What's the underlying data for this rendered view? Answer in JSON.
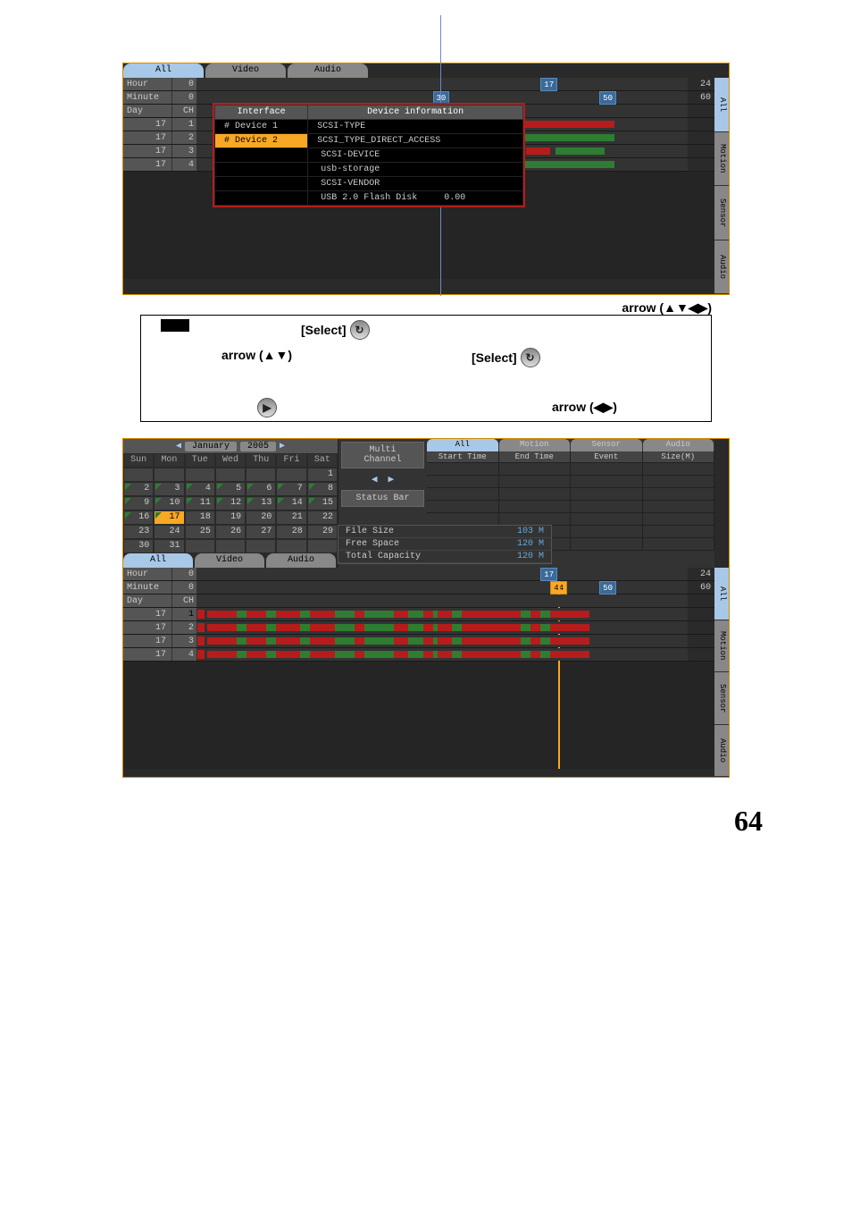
{
  "page_number": "64",
  "screenshot1": {
    "top_tabs": {
      "all": "All",
      "video": "Video",
      "audio": "Audio"
    },
    "side_tabs": {
      "all": "All",
      "motion": "Motion",
      "sensor": "Sensor",
      "audio": "Audio"
    },
    "hour": {
      "label": "Hour",
      "start": "0",
      "cursor": "17",
      "end": "24"
    },
    "minute": {
      "label": "Minute",
      "start": "0",
      "marker": "30",
      "cursor": "50",
      "end": "60"
    },
    "heading": {
      "day": "Day",
      "ch": "CH"
    },
    "channels": [
      {
        "day": "17",
        "ch": "1"
      },
      {
        "day": "17",
        "ch": "2"
      },
      {
        "day": "17",
        "ch": "3"
      },
      {
        "day": "17",
        "ch": "4"
      }
    ],
    "popup": {
      "col_interface": "Interface",
      "col_devinfo": "Device information",
      "device1": "# Device 1",
      "device2": "# Device 2",
      "info": {
        "l1": "SCSI-TYPE",
        "l2": "SCSI_TYPE_DIRECT_ACCESS",
        "l3": "SCSI-DEVICE",
        "l4": "usb-storage",
        "l5": "SCSI-VENDOR",
        "l6": "USB 2.0 Flash Disk",
        "val": "0.00"
      }
    }
  },
  "inter": {
    "arrow4": "arrow (▲▼◀▶)",
    "select": "[Select]",
    "arrow2v": "arrow (▲▼)",
    "arrow2h": "arrow (◀▶)"
  },
  "screenshot2": {
    "calendar": {
      "month": "January",
      "year": "2005",
      "days": [
        "Sun",
        "Mon",
        "Tue",
        "Wed",
        "Thu",
        "Fri",
        "Sat"
      ],
      "cells": [
        [
          "",
          "",
          "",
          "",
          "",
          "",
          "1"
        ],
        [
          "2",
          "3",
          "4",
          "5",
          "6",
          "7",
          "8"
        ],
        [
          "9",
          "10",
          "11",
          "12",
          "13",
          "14",
          "15"
        ],
        [
          "16",
          "17",
          "18",
          "19",
          "20",
          "21",
          "22"
        ],
        [
          "23",
          "24",
          "25",
          "26",
          "27",
          "28",
          "29"
        ],
        [
          "30",
          "31",
          "",
          "",
          "",
          "",
          ""
        ]
      ],
      "hasdata_from": 2,
      "hasdata_to": 17,
      "selected": "17"
    },
    "bottom_tabs": {
      "all": "All",
      "video": "Video",
      "audio": "Audio"
    },
    "mid": {
      "multi": "Multi\nChannel",
      "status": "Status Bar"
    },
    "stats": {
      "filesize_l": "File Size",
      "filesize_v": "103 M",
      "freespace_l": "Free Space",
      "freespace_v": "120 M",
      "total_l": "Total Capacity",
      "total_v": "120 M"
    },
    "right_tabs": {
      "all": "All",
      "motion": "Motion",
      "sensor": "Sensor",
      "audio": "Audio"
    },
    "right_cols": {
      "start": "Start Time",
      "end": "End Time",
      "event": "Event",
      "size": "Size(M)"
    },
    "side_tabs": {
      "all": "All",
      "motion": "Motion",
      "sensor": "Sensor",
      "audio": "Audio"
    },
    "hour": {
      "label": "Hour",
      "start": "0",
      "cursor": "17",
      "end": "24"
    },
    "minute": {
      "label": "Minute",
      "start": "0",
      "marker": "44",
      "cursor": "50",
      "end": "60"
    },
    "heading": {
      "day": "Day",
      "ch": "CH"
    },
    "channels": [
      {
        "day": "17",
        "ch": "1"
      },
      {
        "day": "17",
        "ch": "2"
      },
      {
        "day": "17",
        "ch": "3"
      },
      {
        "day": "17",
        "ch": "4"
      }
    ]
  }
}
